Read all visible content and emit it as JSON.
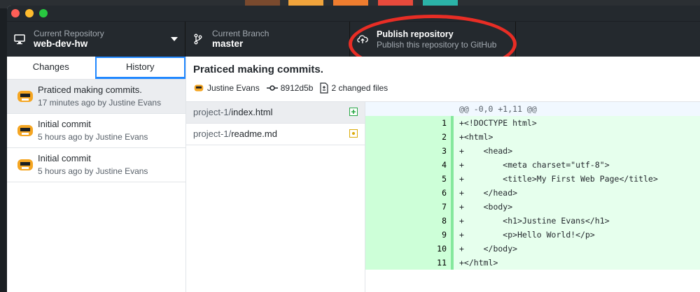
{
  "colors": {
    "toolbar_bg": "#24292e",
    "accent_blue": "#2188ff",
    "annotation_red": "#e82d25",
    "added_bg": "#e6ffed",
    "added_gutter": "#cdffd8"
  },
  "toolbar": {
    "repository": {
      "label": "Current Repository",
      "value": "web-dev-hw",
      "icon": "computer-icon"
    },
    "branch": {
      "label": "Current Branch",
      "value": "master",
      "icon": "branch-icon"
    },
    "publish": {
      "label": "Publish repository",
      "description": "Publish this repository to GitHub",
      "icon": "cloud-upload-icon"
    }
  },
  "tabs": [
    {
      "label": "Changes",
      "active": false
    },
    {
      "label": "History",
      "active": true
    }
  ],
  "commits": [
    {
      "title": "Praticed making commits.",
      "meta": "17 minutes ago by Justine Evans",
      "selected": true
    },
    {
      "title": "Initial commit",
      "meta": "5 hours ago by Justine Evans",
      "selected": false
    },
    {
      "title": "Initial commit",
      "meta": "5 hours ago by Justine Evans",
      "selected": false
    }
  ],
  "commit_detail": {
    "title": "Praticed making commits.",
    "author": "Justine Evans",
    "sha": "8912d5b",
    "changed_files": "2 changed files"
  },
  "files": [
    {
      "dir": "project-1/",
      "name": "index.html",
      "status": "added"
    },
    {
      "dir": "project-1/",
      "name": "readme.md",
      "status": "modified"
    }
  ],
  "diff": {
    "hunk": "@@ -0,0 +1,11 @@",
    "lines": [
      {
        "num": "1",
        "text": "+<!DOCTYPE html>"
      },
      {
        "num": "2",
        "text": "+<html>"
      },
      {
        "num": "3",
        "text": "+    <head>"
      },
      {
        "num": "4",
        "text": "+        <meta charset=\"utf-8\">"
      },
      {
        "num": "5",
        "text": "+        <title>My First Web Page</title>"
      },
      {
        "num": "6",
        "text": "+    </head>"
      },
      {
        "num": "7",
        "text": "+    <body>"
      },
      {
        "num": "8",
        "text": "+        <h1>Justine Evans</h1>"
      },
      {
        "num": "9",
        "text": "+        <p>Hello World!</p>"
      },
      {
        "num": "10",
        "text": "+    </body>"
      },
      {
        "num": "11",
        "text": "+</html>"
      }
    ]
  }
}
